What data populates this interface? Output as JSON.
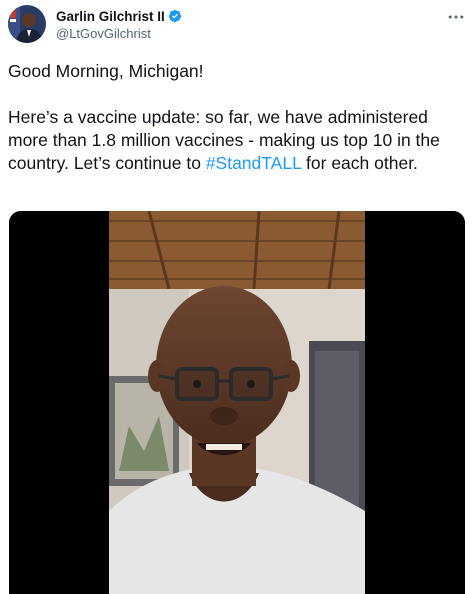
{
  "tweet": {
    "author": {
      "display_name": "Garlin Gilchrist II",
      "handle": "@LtGovGilchrist",
      "verified": true,
      "avatar_icon": "profile-photo"
    },
    "more_icon": "more-icon",
    "text": {
      "line1": "Good Morning, Michigan!",
      "para2_before": "Here’s a vaccine update: so far, we have administered more than 1.8 million vaccines - making us top 10 in the country. Let’s continue to ",
      "hashtag": "#StandTALL",
      "para2_after": " for each other."
    },
    "media": {
      "type": "video",
      "colors": {
        "background": "#000000",
        "hashtag": "#1d9bf0",
        "verified": "#1d9bf0"
      }
    }
  }
}
